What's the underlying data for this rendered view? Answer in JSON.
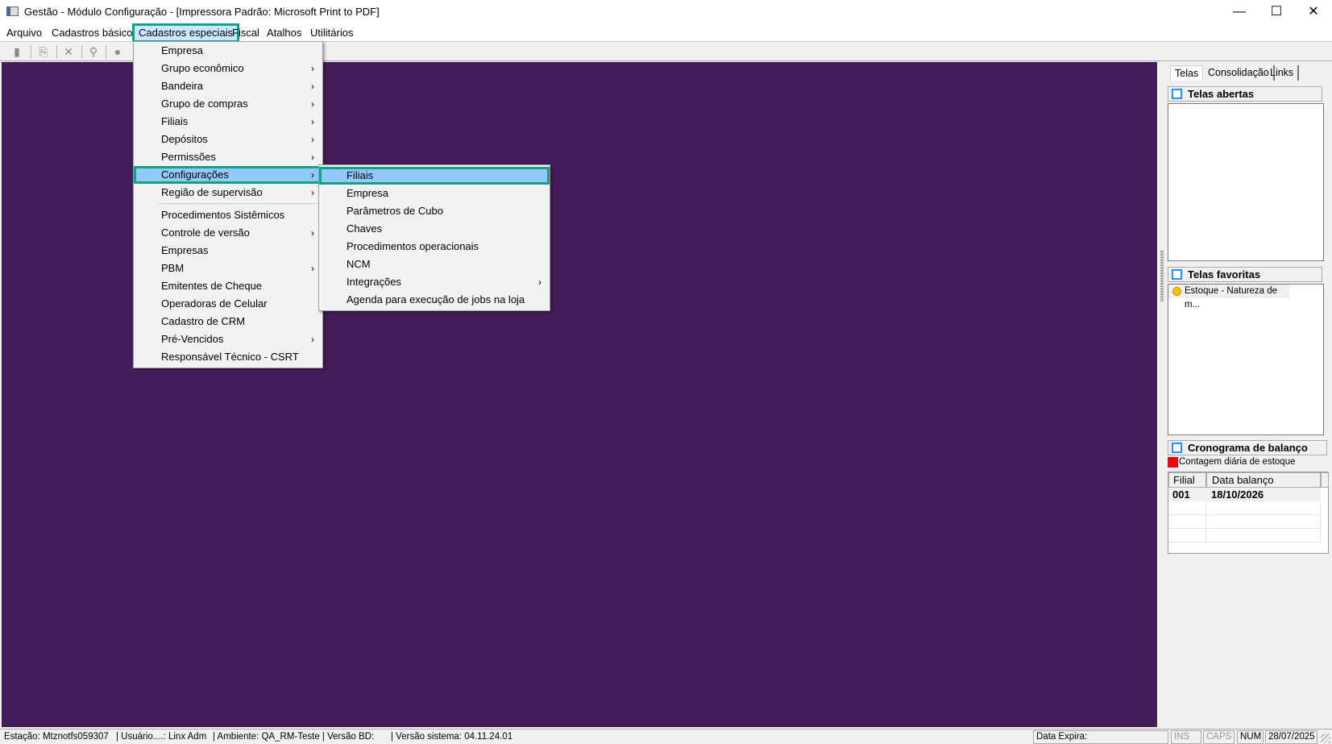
{
  "window": {
    "title": "Gestão  - Módulo Configuração - [Impressora Padrão: Microsoft Print to PDF]",
    "minimize": "—",
    "maximize": "☐",
    "close": "✕"
  },
  "menubar": [
    "Arquivo",
    "Cadastros básicos",
    "Cadastros especiais",
    "Fiscal",
    "Atalhos",
    "Utilitários"
  ],
  "toolbar": {
    "icons": [
      "save-icon",
      "paste-icon",
      "delete-icon",
      "search-icon",
      "record-icon"
    ]
  },
  "menu": {
    "items": [
      {
        "label": "Empresa",
        "arrow": ""
      },
      {
        "label": "Grupo econômico",
        "arrow": "›"
      },
      {
        "label": "Bandeira",
        "arrow": "›"
      },
      {
        "label": "Grupo de compras",
        "arrow": "›"
      },
      {
        "label": "Filiais",
        "arrow": "›"
      },
      {
        "label": "Depósitos",
        "arrow": "›"
      },
      {
        "label": "Permissões",
        "arrow": "›"
      },
      {
        "label": "Configurações",
        "arrow": "›"
      },
      {
        "label": "Região de supervisão",
        "arrow": "›"
      },
      {
        "label": "Procedimentos Sistêmicos",
        "arrow": ""
      },
      {
        "label": "Controle de versão",
        "arrow": "›"
      },
      {
        "label": "Empresas",
        "arrow": ""
      },
      {
        "label": "PBM",
        "arrow": "›"
      },
      {
        "label": "Emitentes de Cheque",
        "arrow": ""
      },
      {
        "label": "Operadoras de Celular",
        "arrow": ""
      },
      {
        "label": "Cadastro de CRM",
        "arrow": ""
      },
      {
        "label": "Pré-Vencidos",
        "arrow": "›"
      },
      {
        "label": "Responsável Técnico - CSRT",
        "arrow": ""
      }
    ]
  },
  "submenu": {
    "items": [
      {
        "label": "Filiais",
        "arrow": ""
      },
      {
        "label": "Empresa",
        "arrow": ""
      },
      {
        "label": "Parâmetros de Cubo",
        "arrow": ""
      },
      {
        "label": "Chaves",
        "arrow": ""
      },
      {
        "label": "Procedimentos operacionais",
        "arrow": ""
      },
      {
        "label": "NCM",
        "arrow": ""
      },
      {
        "label": "Integrações",
        "arrow": "›"
      },
      {
        "label": "Agenda para execução de jobs na loja",
        "arrow": ""
      }
    ]
  },
  "sidebar": {
    "tabs": [
      "Telas",
      "Consolidação",
      "Links"
    ],
    "open_title": "Telas abertas",
    "fav_title": "Telas favoritas",
    "favorites": [
      "Estoque - Natureza de m..."
    ],
    "schedule_title": "Cronograma de balanço",
    "legend": "Contagem diária de estoque",
    "legend_color": "#ff0000",
    "columns": [
      "Filial",
      "Data balanço"
    ],
    "rows": [
      [
        "001",
        "18/10/2026"
      ]
    ]
  },
  "status": {
    "station": "Estação: Mtznotfs059307",
    "user": "| Usuário....: Linx Adm",
    "env": "| Ambiente: QA_RM-Teste | Versão BD:",
    "version": "| Versão sistema: 04.11.24.01",
    "expira": "Data Expira:",
    "ins": "INS",
    "caps": "CAPS",
    "num": "NUM",
    "date": "28/07/2025"
  },
  "colors": {
    "desktop": "#431c5a",
    "highlight": "#91c9f7",
    "focus": "#17a085"
  }
}
